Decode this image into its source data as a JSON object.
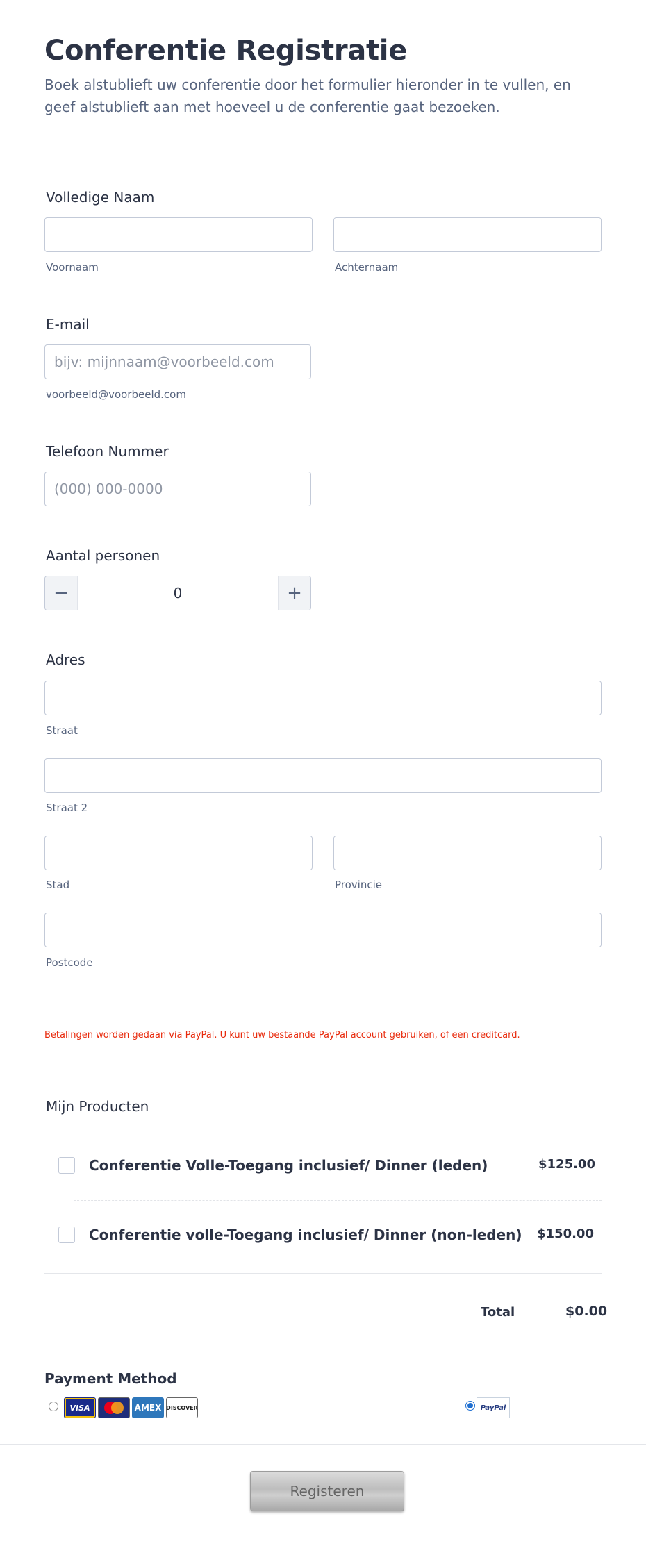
{
  "header": {
    "title": "Conferentie Registratie",
    "subtitle": "Boek alstublieft uw conferentie door het formulier hieronder in te vullen, en geef alstublieft aan met hoeveel u de conferentie gaat bezoeken."
  },
  "full_name": {
    "label": "Volledige Naam",
    "first_sublabel": "Voornaam",
    "last_sublabel": "Achternaam",
    "first_value": "",
    "last_value": ""
  },
  "email": {
    "label": "E-mail",
    "placeholder": "bijv: mijnnaam@voorbeeld.com",
    "sublabel": "voorbeeld@voorbeeld.com"
  },
  "phone": {
    "label": "Telefoon Nummer",
    "placeholder": "(000) 000-0000"
  },
  "persons": {
    "label": "Aantal personen",
    "value": "0",
    "minus": "−",
    "plus": "+"
  },
  "address": {
    "label": "Adres",
    "street": "Straat",
    "street2": "Straat 2",
    "city": "Stad",
    "province": "Provincie",
    "postcode": "Postcode"
  },
  "payment_note": "Betalingen worden gedaan via PayPal.  U kunt uw bestaande PayPal account gebruiken, of een creditcard.",
  "products": {
    "label": "Mijn Producten",
    "items": [
      {
        "name": "Conferentie Volle-Toegang inclusief/ Dinner (leden)",
        "price": "$125.00"
      },
      {
        "name": "Conferentie volle-Toegang inclusief/ Dinner (non-leden)",
        "price": "$150.00"
      }
    ],
    "total_label": "Total",
    "total_value": "$0.00"
  },
  "payment": {
    "label": "Payment Method",
    "cards": [
      "VISA",
      "MasterCard",
      "AMEX",
      "DISCOVER"
    ],
    "paypal": "PayPal",
    "selected": "paypal"
  },
  "submit_label": "Registeren",
  "colors": {
    "text": "#2c3345",
    "muted": "#57647e",
    "note": "#e8290b",
    "radio_selected": "#1f6fd1"
  }
}
